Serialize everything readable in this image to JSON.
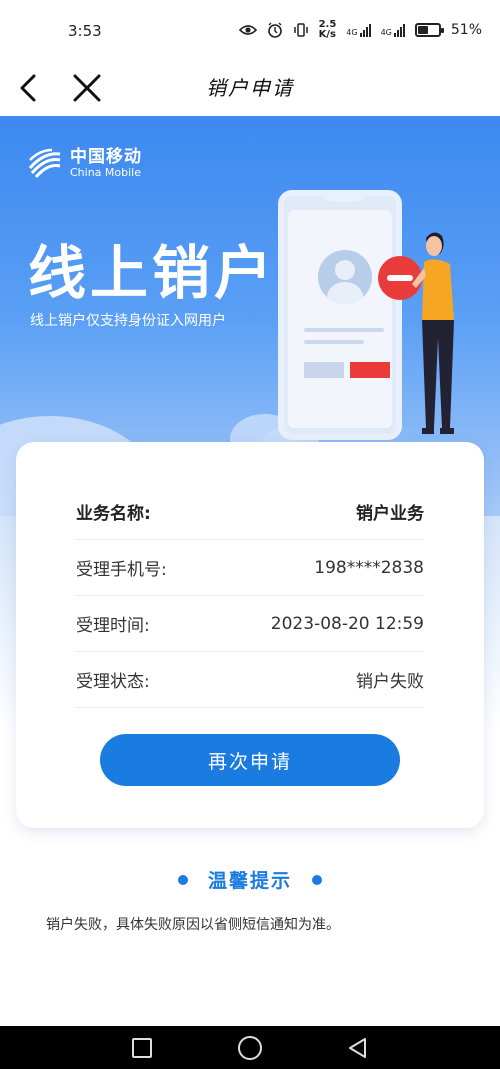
{
  "status_bar": {
    "time": "3:53",
    "speed_value": "2.5",
    "speed_unit": "K/s",
    "sim1_label": "4G",
    "sim2_label": "4G",
    "battery_level": 0.51,
    "battery_text": "51%"
  },
  "nav": {
    "title": "销户申请",
    "back_icon": "chevron-left-icon",
    "close_icon": "close-icon"
  },
  "banner": {
    "brand_cn": "中国移动",
    "brand_en": "China Mobile",
    "title": "线上销户",
    "subtitle": "线上销户仅支持身份证入网用户"
  },
  "details": {
    "rows": [
      {
        "label": "业务名称:",
        "value": "销户业务"
      },
      {
        "label": "受理手机号:",
        "value": "198****2838"
      },
      {
        "label": "受理时间:",
        "value": "2023-08-20 12:59"
      },
      {
        "label": "受理状态:",
        "value": "销户失败"
      }
    ],
    "reapply_label": "再次申请"
  },
  "tips": {
    "title": "温馨提示",
    "text": "销户失败，具体失败原因以省侧短信通知为准。"
  },
  "colors": {
    "accent": "#1a7be0",
    "banner_top": "#3d89f0",
    "danger": "#ea3b3b"
  }
}
